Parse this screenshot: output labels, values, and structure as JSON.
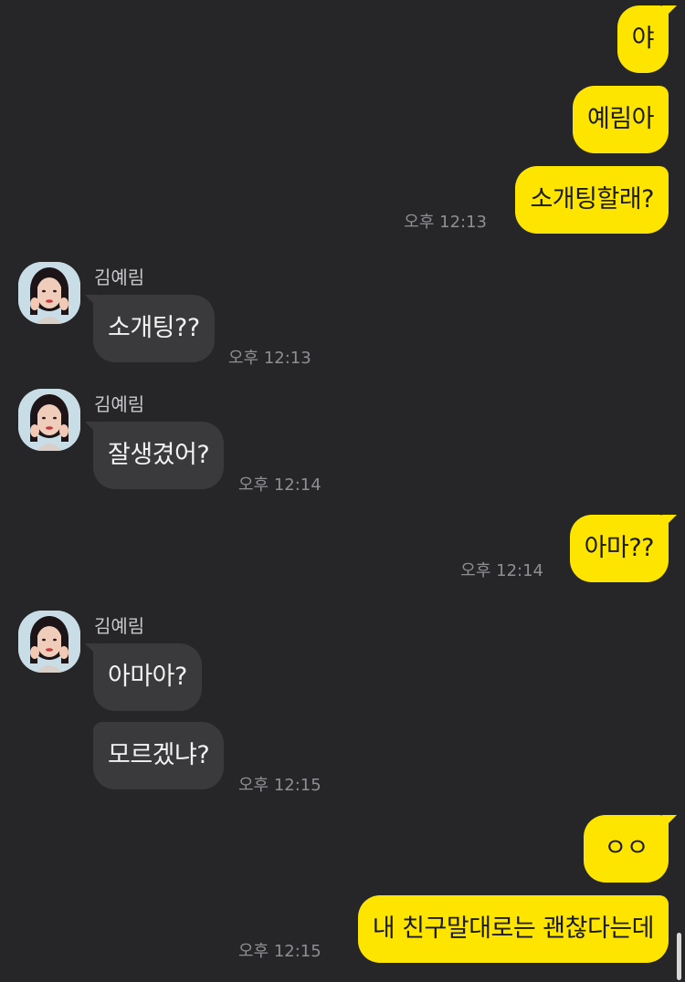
{
  "contact": {
    "name": "김예림",
    "avatar_icon": "profile-photo-avatar"
  },
  "messages": {
    "m1": {
      "from": "me",
      "text": "야"
    },
    "m2": {
      "from": "me",
      "text": "예림아"
    },
    "m3": {
      "from": "me",
      "text": "소개팅할래?",
      "time": "오후 12:13"
    },
    "m4": {
      "from": "other",
      "sender": "김예림",
      "text": "소개팅??",
      "time": "오후 12:13"
    },
    "m5": {
      "from": "other",
      "sender": "김예림",
      "text": "잘생겼어?",
      "time": "오후 12:14"
    },
    "m6": {
      "from": "me",
      "text": "아마??",
      "time": "오후 12:14"
    },
    "m7": {
      "from": "other",
      "sender": "김예림",
      "text": "아마아?"
    },
    "m8": {
      "from": "other",
      "text": "모르겠냐?",
      "time": "오후 12:15"
    },
    "m9": {
      "from": "me",
      "text": "ㅇㅇ"
    },
    "m10": {
      "from": "me",
      "text": "내 친구말대로는 괜찮다는데",
      "time": "오후 12:15"
    }
  },
  "colors": {
    "background": "#262629",
    "my_bubble": "#fee500",
    "other_bubble": "#3a3a3d",
    "timestamp": "#8e8e93"
  }
}
